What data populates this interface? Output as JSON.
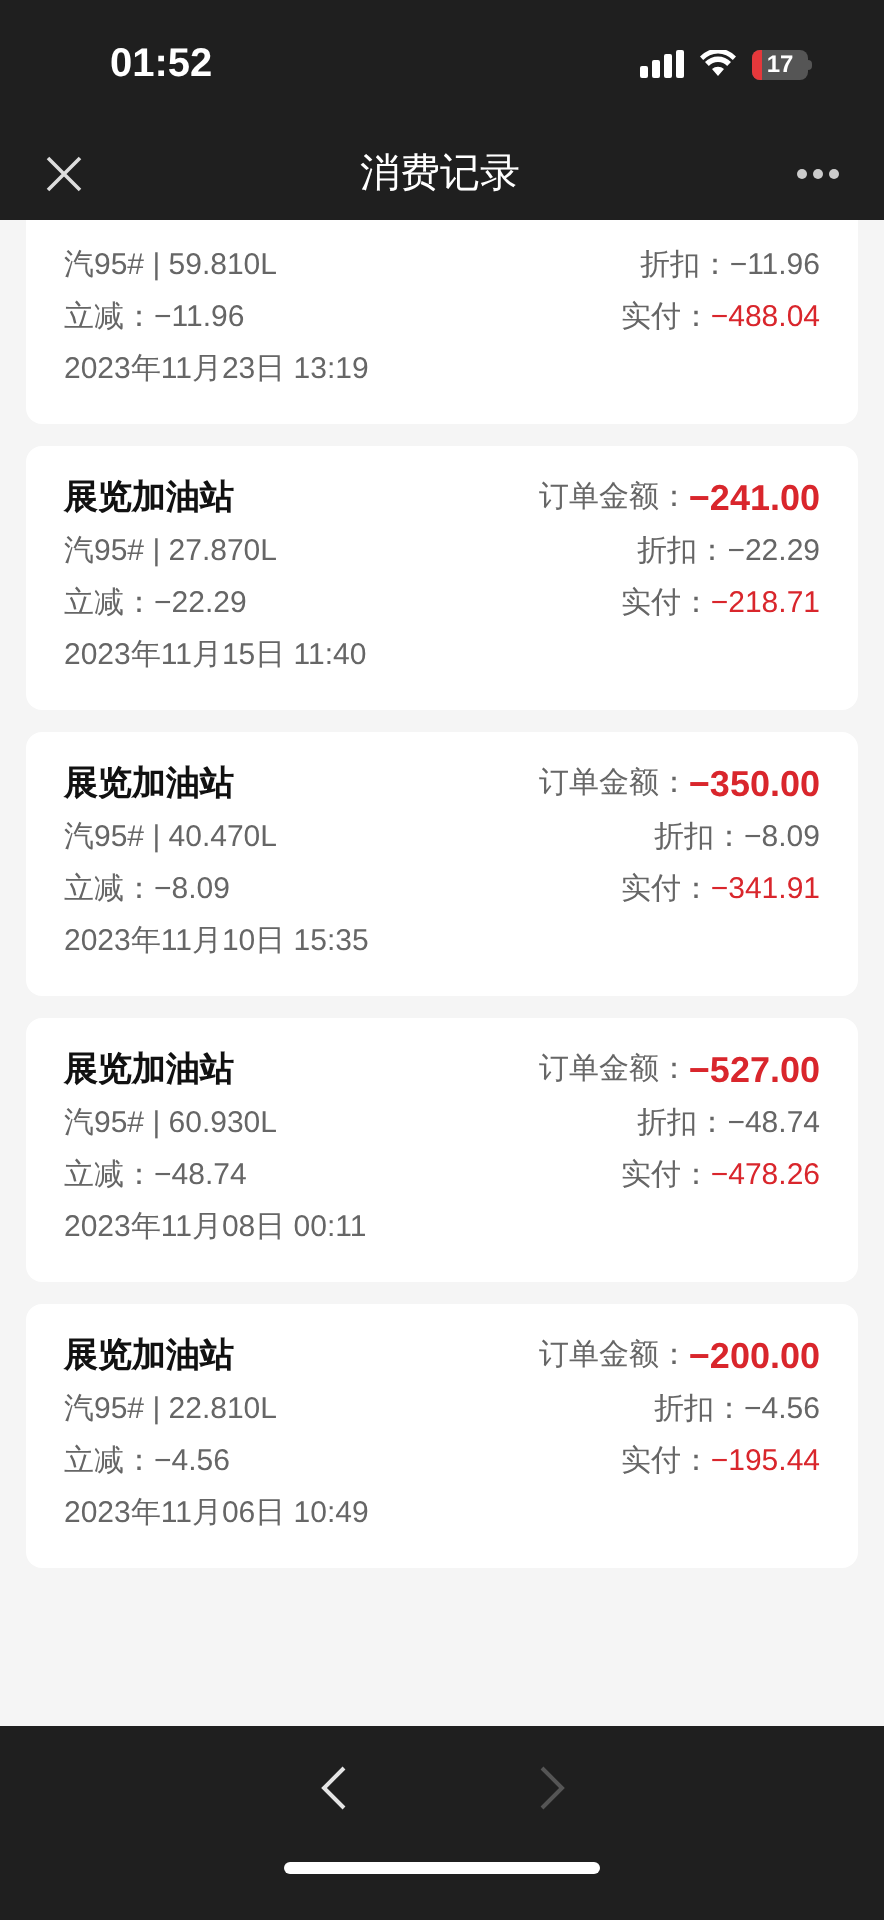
{
  "status_bar": {
    "time": "01:52",
    "battery": "17"
  },
  "header": {
    "title": "消费记录"
  },
  "records": [
    {
      "fuel": "汽95# | 59.810L",
      "discount_label": "折扣：",
      "discount": "−11.96",
      "reduction_label": "立减：",
      "reduction": "−11.96",
      "paid_label": "实付：",
      "paid": "−488.04",
      "date": "2023年11月23日 13:19"
    },
    {
      "station": "展览加油站",
      "amount_label": "订单金额：",
      "amount": "−241.00",
      "fuel": "汽95# | 27.870L",
      "discount_label": "折扣：",
      "discount": "−22.29",
      "reduction_label": "立减：",
      "reduction": "−22.29",
      "paid_label": "实付：",
      "paid": "−218.71",
      "date": "2023年11月15日 11:40"
    },
    {
      "station": "展览加油站",
      "amount_label": "订单金额：",
      "amount": "−350.00",
      "fuel": "汽95# | 40.470L",
      "discount_label": "折扣：",
      "discount": "−8.09",
      "reduction_label": "立减：",
      "reduction": "−8.09",
      "paid_label": "实付：",
      "paid": "−341.91",
      "date": "2023年11月10日 15:35"
    },
    {
      "station": "展览加油站",
      "amount_label": "订单金额：",
      "amount": "−527.00",
      "fuel": "汽95# | 60.930L",
      "discount_label": "折扣：",
      "discount": "−48.74",
      "reduction_label": "立减：",
      "reduction": "−48.74",
      "paid_label": "实付：",
      "paid": "−478.26",
      "date": "2023年11月08日 00:11"
    },
    {
      "station": "展览加油站",
      "amount_label": "订单金额：",
      "amount": "−200.00",
      "fuel": "汽95# | 22.810L",
      "discount_label": "折扣：",
      "discount": "−4.56",
      "reduction_label": "立减：",
      "reduction": "−4.56",
      "paid_label": "实付：",
      "paid": "−195.44",
      "date": "2023年11月06日 10:49"
    }
  ],
  "nav": {
    "back": {
      "disabled": false
    },
    "forward": {
      "disabled": true
    }
  }
}
